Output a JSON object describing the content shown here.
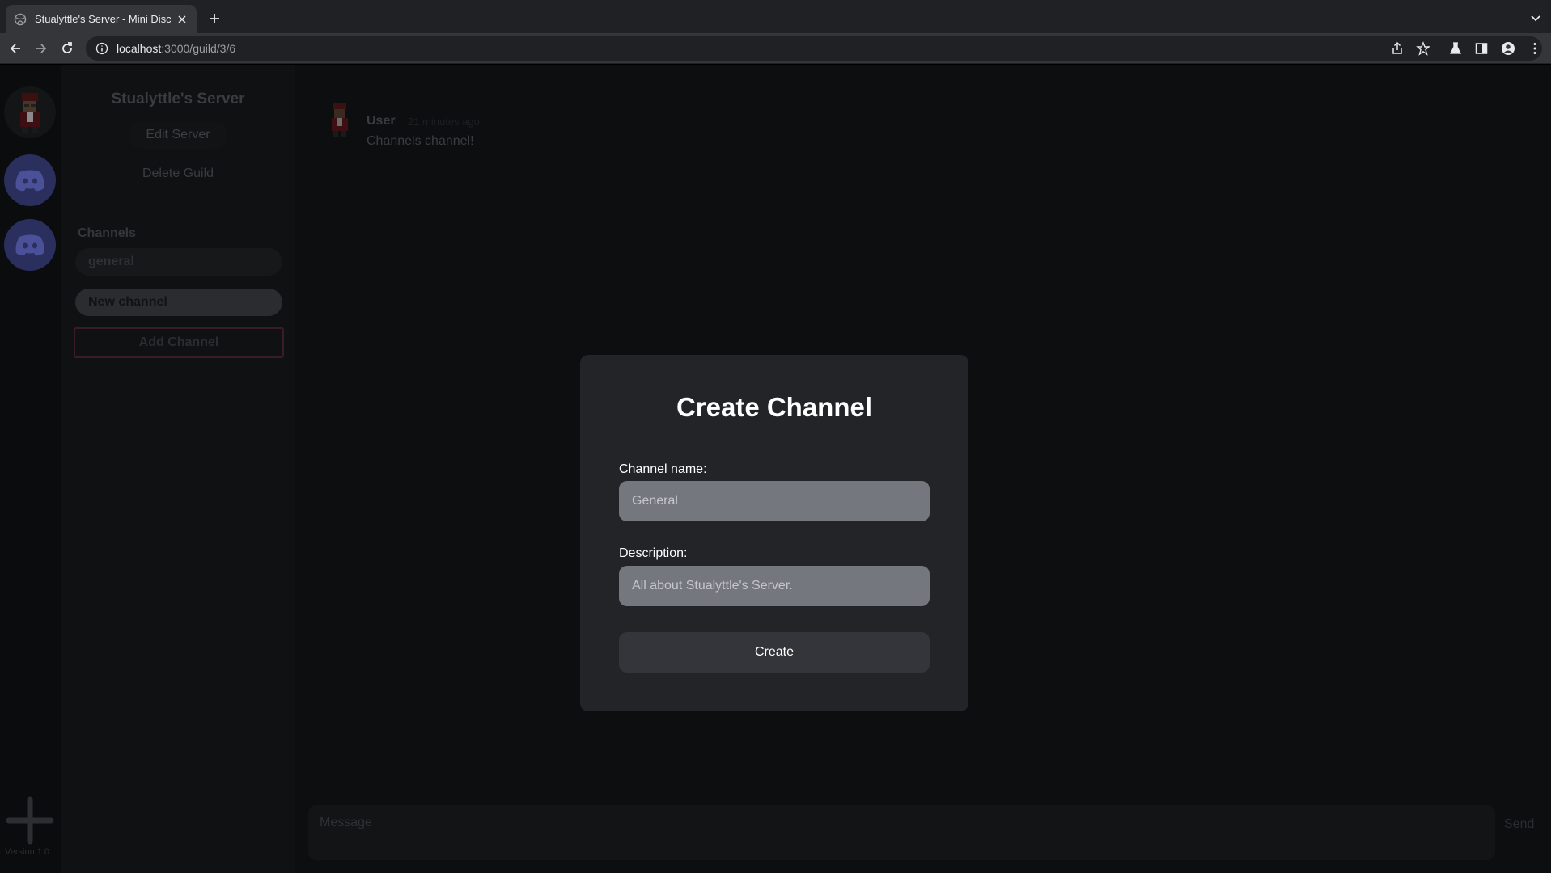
{
  "browser": {
    "tab_title": "Stualyttle's Server - Mini Discord",
    "url_host": "localhost",
    "url_path": ":3000/guild/3/6"
  },
  "rail": {
    "version": "Version 1.0"
  },
  "server": {
    "name": "Stualyttle's Server",
    "edit_label": "Edit Server",
    "delete_label": "Delete Guild",
    "channels_heading": "Channels",
    "channels": [
      {
        "label": "general"
      },
      {
        "label": "New channel"
      }
    ],
    "add_channel_label": "Add Channel"
  },
  "chat": {
    "messages": [
      {
        "user": "User",
        "time": "21 minutes ago",
        "text": "Channels channel!"
      }
    ],
    "composer_placeholder": "Message",
    "send_label": "Send"
  },
  "modal": {
    "title": "Create Channel",
    "name_label": "Channel name:",
    "name_placeholder": "General",
    "desc_label": "Description:",
    "desc_placeholder": "All about Stualyttle's Server.",
    "submit_label": "Create"
  },
  "colors": {
    "modal_bg": "#232428",
    "input_bg": "#75777f",
    "discord_blurple_dim": "#2a2f5e",
    "add_channel_border": "#3a1c22"
  }
}
